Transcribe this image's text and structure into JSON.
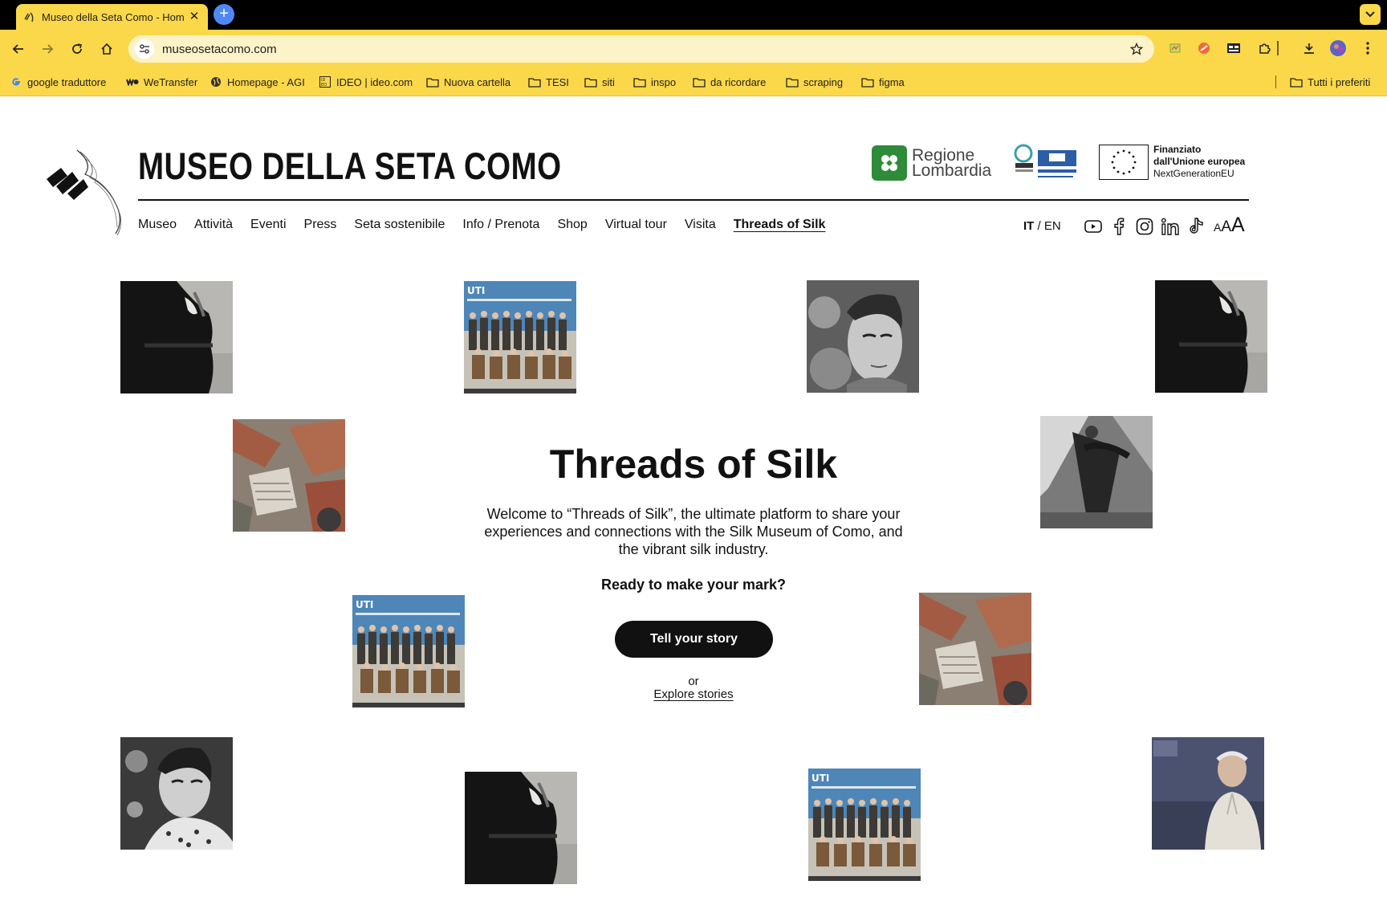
{
  "browser": {
    "tab_title": "Museo della Seta Como - Hom",
    "url": "museosetacomo.com",
    "new_tab_symbol": "+",
    "bookmarks": [
      {
        "label": "google traduttore",
        "icon": "google-icon"
      },
      {
        "label": "WeTransfer",
        "icon": "wetransfer-icon"
      },
      {
        "label": "Homepage - AGI",
        "icon": "globe-icon"
      },
      {
        "label": "IDEO | ideo.com",
        "icon": "ideo-icon"
      },
      {
        "label": "Nuova cartella",
        "icon": "folder-icon"
      },
      {
        "label": "TESI",
        "icon": "folder-icon"
      },
      {
        "label": "siti",
        "icon": "folder-icon"
      },
      {
        "label": "inspo",
        "icon": "folder-icon"
      },
      {
        "label": "da ricordare",
        "icon": "folder-icon"
      },
      {
        "label": "scraping",
        "icon": "folder-icon"
      },
      {
        "label": "figma",
        "icon": "folder-icon"
      }
    ],
    "all_bookmarks_label": "Tutti i preferiti",
    "colors": {
      "chrome": "#fbd84a",
      "omnibox": "#fdf3c8",
      "tabbar": "#000000",
      "newtab": "#4f88f5"
    }
  },
  "site": {
    "title": "MUSEO DELLA SETA COMO",
    "sponsors": {
      "regione_line1": "Regione",
      "regione_line2": "Lombardia",
      "eu_line1": "Finanziato",
      "eu_line2": "dall'Unione europea",
      "eu_line3": "NextGenerationEU"
    },
    "nav": [
      "Museo",
      "Attività",
      "Eventi",
      "Press",
      "Seta sostenibile",
      "Info / Prenota",
      "Shop",
      "Virtual tour",
      "Visita",
      "Threads of Silk"
    ],
    "active_nav": "Threads of Silk",
    "lang": {
      "it": "IT",
      "sep": " / ",
      "en": "EN"
    },
    "social_icons": [
      "youtube-icon",
      "facebook-icon",
      "instagram-icon",
      "linkedin-icon",
      "tiktok-icon"
    ],
    "font_size_controls": [
      "A",
      "A",
      "A"
    ]
  },
  "hero": {
    "title": "Threads of Silk",
    "body": "Welcome to “Threads of Silk”, the ultimate platform to share your experiences and connections with the Silk Museum of Como, and the vibrant silk industry.",
    "question": "Ready to make your mark?",
    "cta_label": "Tell your story",
    "or_label": "or",
    "explore_label": "Explore stories"
  }
}
